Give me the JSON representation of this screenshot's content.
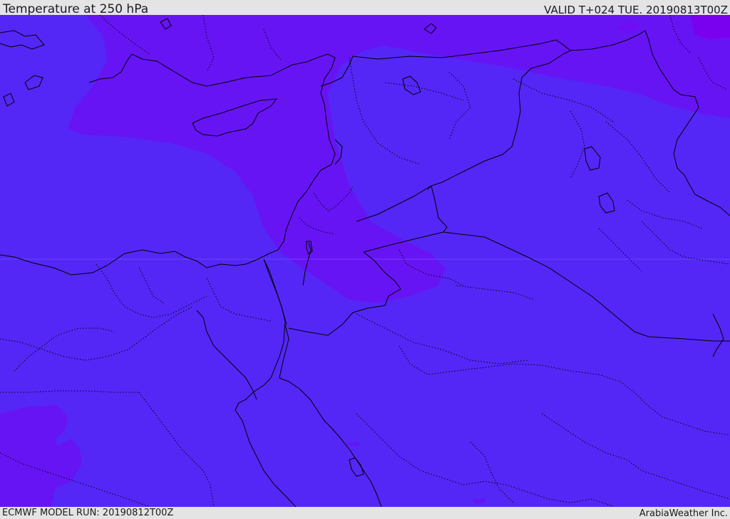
{
  "header": {
    "title": "Temperature at 250 hPa",
    "valid": "VALID T+024 TUE. 20190813T00Z"
  },
  "footer": {
    "model_run": "ECMWF MODEL RUN: 20190812T00Z",
    "provider": "ArabiaWeather Inc."
  },
  "colors": {
    "base_fill": "#5427f7",
    "warm_band": "#6714f5",
    "warmest_spot": "#7a00f0",
    "border_line": "#000000",
    "frame": "#e4e4e4"
  }
}
